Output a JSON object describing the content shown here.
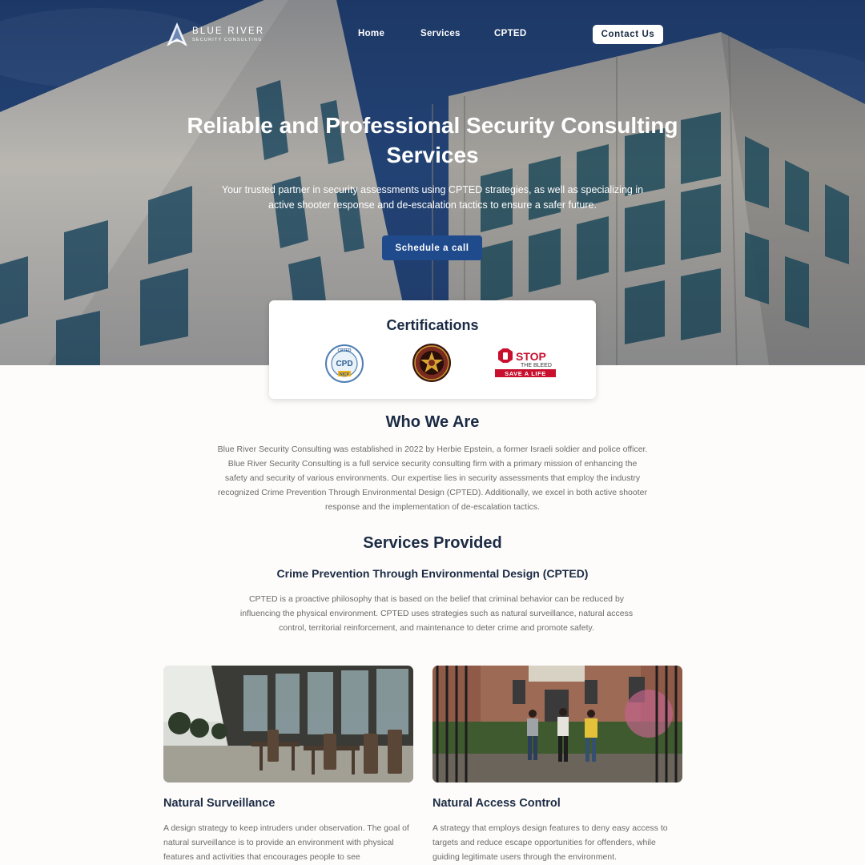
{
  "nav": {
    "logo_line1": "BLUE RIVER",
    "logo_line2": "SECURITY CONSULTING",
    "home": "Home",
    "services": "Services",
    "cpted": "CPTED",
    "contact": "Contact Us"
  },
  "hero": {
    "title": "Reliable and Professional Security Consulting Services",
    "subtitle": "Your trusted partner in security assessments using CPTED strategies, as well as specializing in active shooter response and de-escalation tactics to ensure a safer future.",
    "cta": "Schedule a call"
  },
  "certifications": {
    "title": "Certifications",
    "badges": [
      {
        "name": "CPTED",
        "inner": "CPD",
        "sub": "NICP"
      },
      {
        "name": "law-enforcement-star-badge"
      },
      {
        "name": "STOP THE BLEED",
        "line1": "STOP",
        "line2": "THE BLEED",
        "line3": "SAVE A LIFE"
      }
    ]
  },
  "who": {
    "title": "Who We Are",
    "text": "Blue River Security Consulting was established in 2022 by Herbie Epstein, a former Israeli soldier and police officer. Blue River Security Consulting is a full service security consulting firm with a primary mission of enhancing the safety and security of various environments. Our expertise lies in security assessments that employ the industry recognized Crime Prevention Through Environmental Design (CPTED). Additionally, we excel in both active shooter response and the implementation of de-escalation tactics."
  },
  "services": {
    "title": "Services Provided",
    "cpted_title": "Crime Prevention Through Environmental Design (CPTED)",
    "cpted_text": "CPTED is a proactive philosophy that is based on the belief that criminal behavior can be reduced by influencing the physical environment. CPTED uses strategies such as natural surveillance, natural access control, territorial reinforcement, and maintenance to deter crime and promote safety.",
    "cards": [
      {
        "title": "Natural Surveillance",
        "text": "A design strategy to keep intruders under observation. The goal of natural surveillance is to provide an environment with physical features and activities that encourages people to see"
      },
      {
        "title": "Natural Access Control",
        "text": "A strategy that employs design features to deny easy access to targets and reduce escape opportunities for offenders, while guiding legitimate users through the environment."
      }
    ]
  },
  "colors": {
    "primary": "#1c2b45",
    "cta": "#1f4a8c",
    "text_muted": "#6b6b6b"
  }
}
